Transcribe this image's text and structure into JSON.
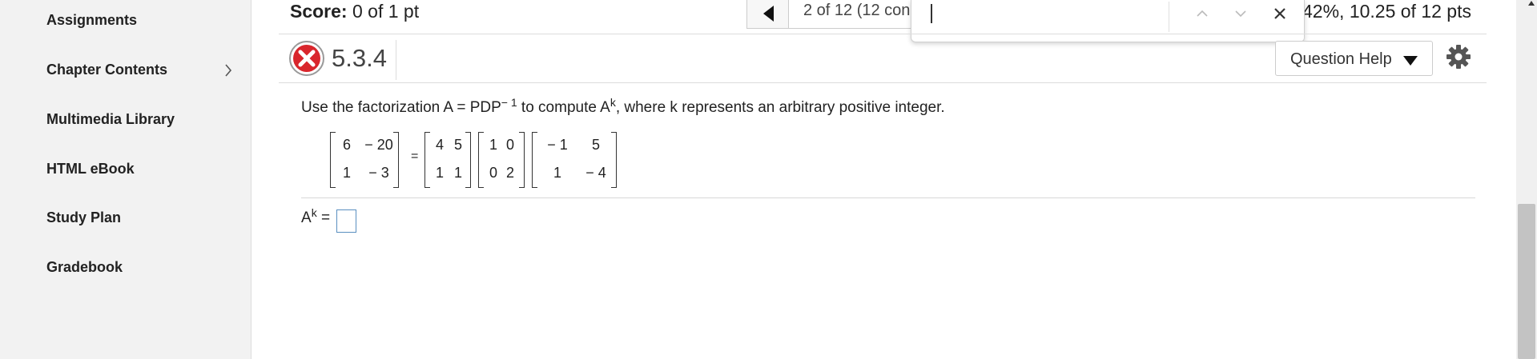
{
  "sidebar": {
    "items": [
      {
        "label": "Assignments"
      },
      {
        "label": "Chapter Contents"
      },
      {
        "label": "Multimedia Library"
      },
      {
        "label": "HTML eBook"
      },
      {
        "label": "Study Plan"
      },
      {
        "label": "Gradebook"
      }
    ]
  },
  "header": {
    "score_label": "Score:",
    "score_value": "0 of 1 pt",
    "nav_text": "2 of 12 (12 con",
    "overall": "42%, 10.25 of 12 pts"
  },
  "findbar": {
    "value": ""
  },
  "question": {
    "id": "5.3.4",
    "status": "incorrect",
    "help_label": "Question Help",
    "prompt_pre": "Use the factorization A = PDP",
    "prompt_exp": "− 1",
    "prompt_mid": " to compute A",
    "prompt_k": "k",
    "prompt_post": ", where k represents an arbitrary positive integer.",
    "equals": "=",
    "matrices": {
      "A": [
        [
          "6",
          "− 20"
        ],
        [
          "1",
          "− 3"
        ]
      ],
      "P": [
        [
          "4",
          "5"
        ],
        [
          "1",
          "1"
        ]
      ],
      "D": [
        [
          "1",
          "0"
        ],
        [
          "0",
          "2"
        ]
      ],
      "Pinv": [
        [
          "− 1",
          "5"
        ],
        [
          "1",
          "− 4"
        ]
      ]
    },
    "answer_label_base": "A",
    "answer_label_exp": "k",
    "answer_label_eq": " ="
  },
  "colors": {
    "incorrect_red": "#d9262c",
    "input_border": "#5a8fc0"
  }
}
